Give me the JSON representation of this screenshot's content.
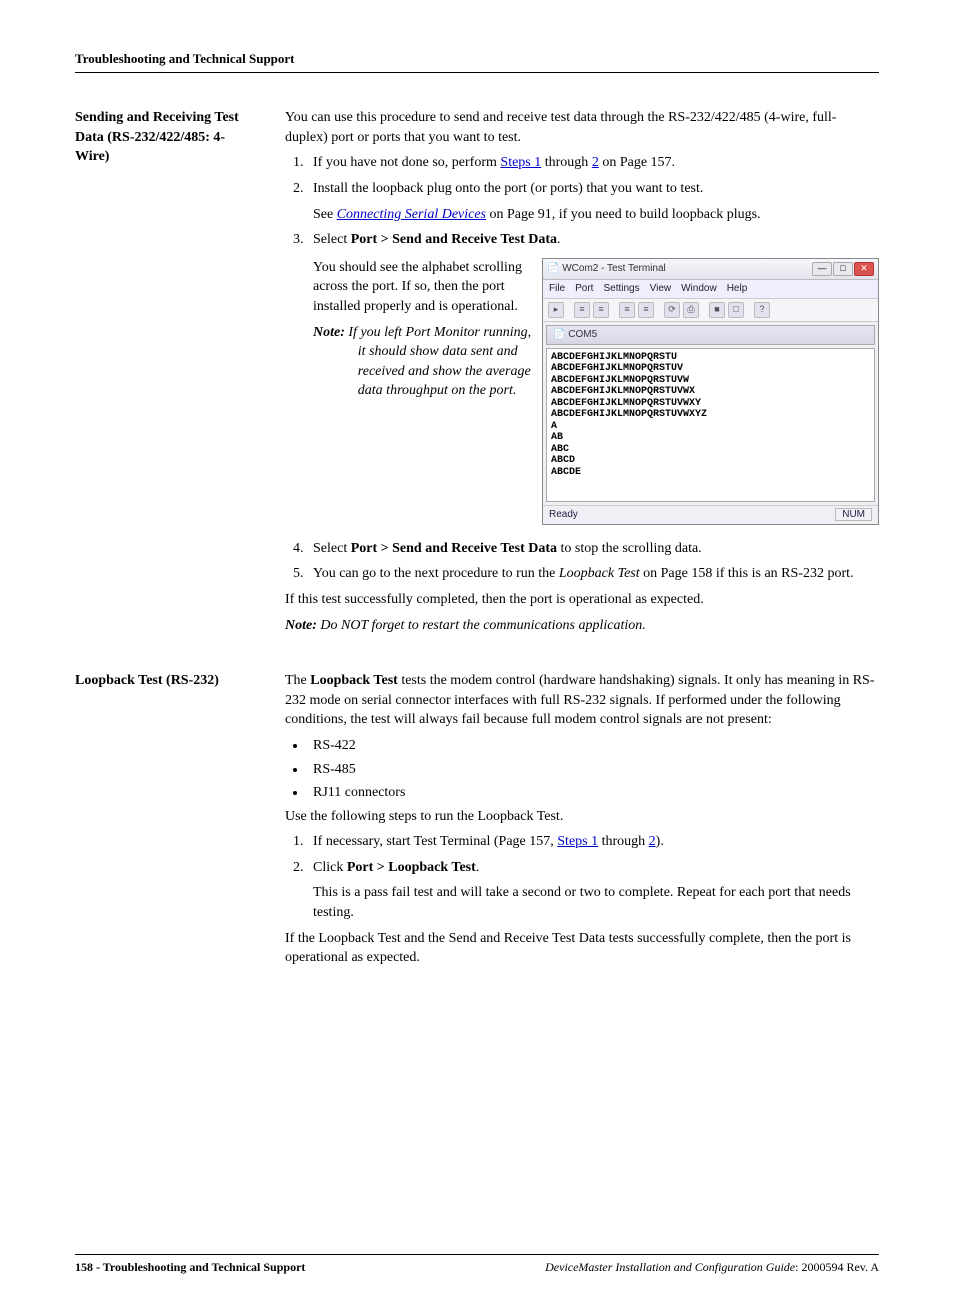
{
  "header": {
    "title": "Troubleshooting and Technical Support"
  },
  "section1": {
    "title": "Sending and Receiving Test Data (RS-232/422/485: 4-Wire)",
    "intro": "You can use this procedure to send and receive test data through the RS-232/422/485 (4-wire, full-duplex) port or ports that you want to test.",
    "step1_pre": "If you have not done so, perform ",
    "step1_link1": "Steps 1",
    "step1_mid": " through ",
    "step1_link2": "2",
    "step1_post": " on Page 157.",
    "step2": "Install the loopback plug onto the port (or ports) that you want to test.",
    "step2_sub_pre": "See ",
    "step2_sub_link": "Connecting Serial Devices",
    "step2_sub_post": " on Page 91, if you need to build loopback plugs.",
    "step3_pre": "Select ",
    "step3_bold": "Port > Send and Receive Test Data",
    "step3_post": ".",
    "step3_sub": "You should see the alphabet scrolling across the port. If so, then the port installed properly and is operational.",
    "step3_note_label": "Note:",
    "step3_note_body": "If you left Port Monitor running, it should show data sent and received and show the average data throughput on the port.",
    "step4_pre": "Select ",
    "step4_bold": "Port > Send and Receive Test Data",
    "step4_post": " to stop the scrolling data.",
    "step5_pre": "You can go to the next procedure to run the ",
    "step5_it": "Loopback Test",
    "step5_post": " on Page 158 if this is an RS-232 port.",
    "conclude": "If this test successfully completed, then the port is operational as expected.",
    "final_note_label": "Note:",
    "final_note_body": "Do NOT forget to restart the communications application."
  },
  "screenshot": {
    "window_title": "WCom2 - Test Terminal",
    "menus": {
      "m1": "File",
      "m2": "Port",
      "m3": "Settings",
      "m4": "View",
      "m5": "Window",
      "m6": "Help"
    },
    "com_label": "COM5",
    "body": "ABCDEFGHIJKLMNOPQRSTU\nABCDEFGHIJKLMNOPQRSTUV\nABCDEFGHIJKLMNOPQRSTUVW\nABCDEFGHIJKLMNOPQRSTUVWX\nABCDEFGHIJKLMNOPQRSTUVWXY\nABCDEFGHIJKLMNOPQRSTUVWXYZ\nA\nAB\nABC\nABCD\nABCDE",
    "status_left": "Ready",
    "status_right": "NUM"
  },
  "section2": {
    "title": "Loopback Test (RS-232)",
    "intro_pre": "The ",
    "intro_bold": "Loopback Test",
    "intro_post": " tests the modem control (hardware handshaking) signals. It only has meaning in RS-232 mode on serial connector interfaces with full RS-232 signals. If performed under the following conditions, the test will always fail because full modem control signals are not present:",
    "b1": "RS-422",
    "b2": "RS-485",
    "b3": "RJ11 connectors",
    "use": "Use the following steps to run the Loopback Test.",
    "s1_pre": "If necessary, start Test Terminal (Page 157, ",
    "s1_link1": "Steps 1",
    "s1_mid": " through  ",
    "s1_link2": "2",
    "s1_post": ").",
    "s2_pre": "Click ",
    "s2_bold": "Port > Loopback Test",
    "s2_post": ".",
    "s2_sub": "This is a pass fail test and will take a second or two to complete. Repeat for each port that needs testing.",
    "conclude": "If the Loopback Test and the Send and Receive Test Data tests successfully complete, then the port is operational as expected."
  },
  "footer": {
    "page_label": "158 - Troubleshooting and Technical Support",
    "doc_title": "DeviceMaster Installation and Configuration Guide",
    "doc_rev": ": 2000594 Rev. A"
  }
}
